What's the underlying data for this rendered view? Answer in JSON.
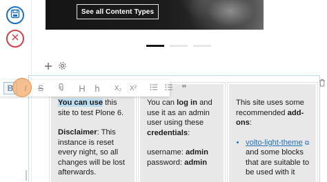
{
  "hero": {
    "button_label": "See all Content Types"
  },
  "carousel": {
    "dots": [
      true,
      false,
      false
    ]
  },
  "block_controls": {
    "add_symbol": "+",
    "settings_symbol": "⚙"
  },
  "toolbar": {
    "bold": "B",
    "italic": "I",
    "strikethrough": "S",
    "link": "🔗",
    "heading2": "H",
    "heading3": "h",
    "subscript": "X₂",
    "superscript": "X²",
    "numbered_list": "☰",
    "bulleted_list": "☰",
    "blockquote": "❞"
  },
  "columns": [
    {
      "p1_selected": "You can use",
      "p1_rest": " this site to test Plone 6.",
      "p2_label": "Disclaimer",
      "p2_rest": ": This instance is reset every night, so all changes will be lost afterwards."
    },
    {
      "p1_a": "You can ",
      "p1_b": "log in",
      "p1_c": " and use it as an admin user using these ",
      "p1_d": "credentials",
      "p1_e": ":",
      "username_label": "username: ",
      "username_value": "admin",
      "password_label": "password: ",
      "password_value": "admin"
    },
    {
      "p1_a": "This site uses some recommended ",
      "p1_b": "add-ons",
      "p1_c": ":",
      "link_text": "volto-light-theme",
      "item_rest": " and some blocks that are suitable to be used with it"
    }
  ],
  "colors": {
    "accent": "#1e6fc0",
    "danger": "#d33f4a",
    "highlight": "#f2aa6e",
    "selection": "#b9dcee"
  }
}
